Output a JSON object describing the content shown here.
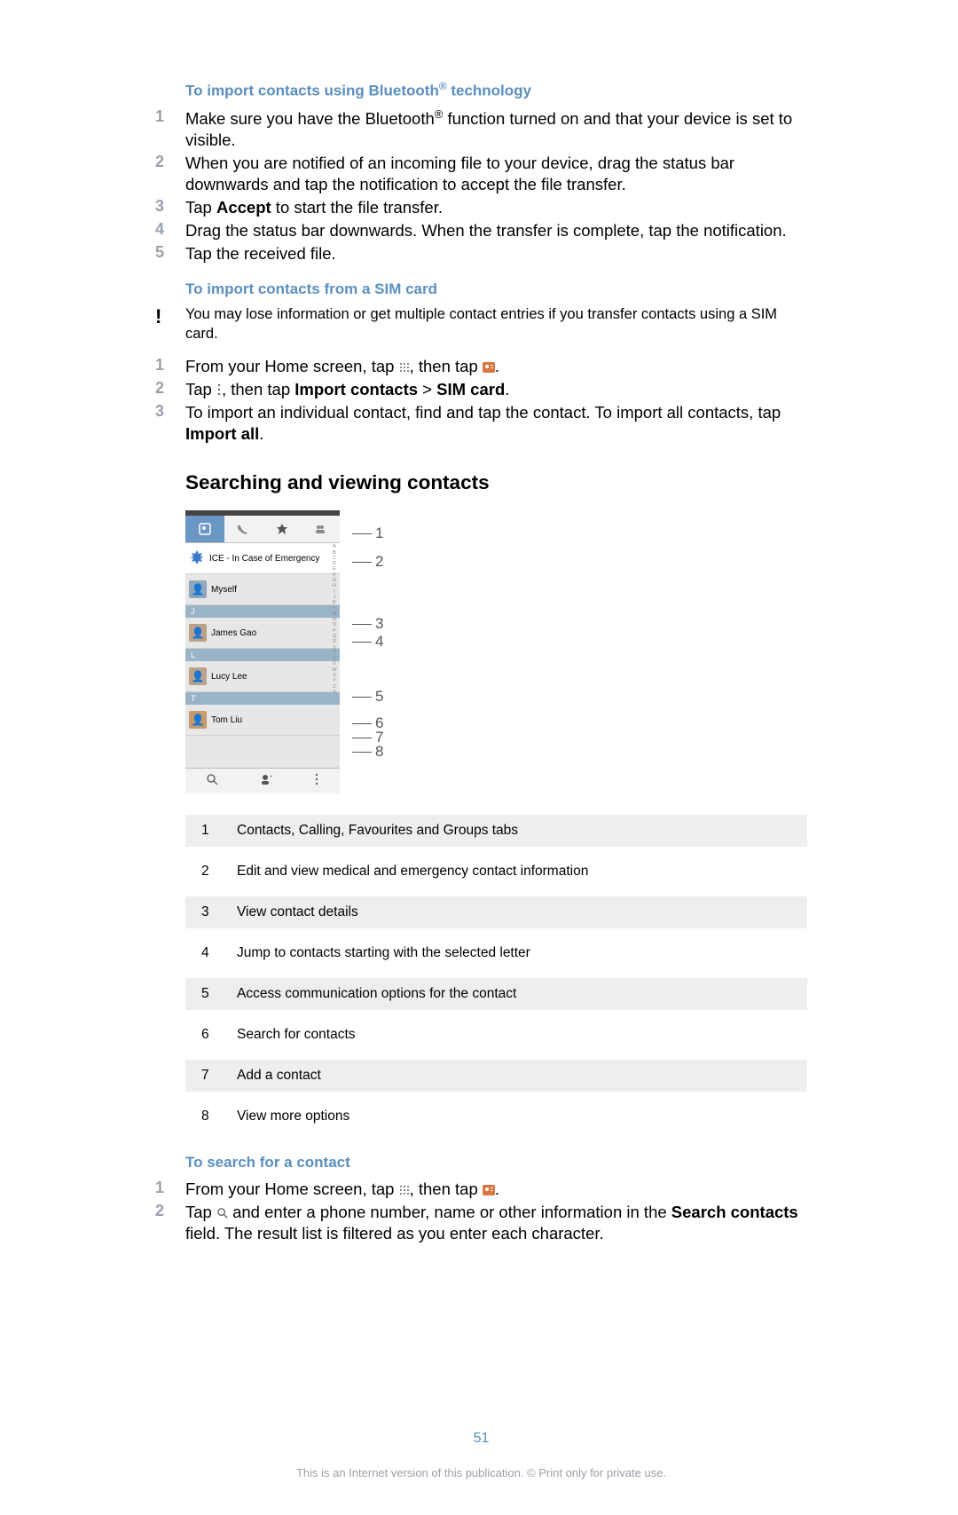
{
  "sections": {
    "bt_heading": "To import contacts using Bluetooth",
    "bt_sup": "®",
    "bt_heading2": " technology",
    "bt_steps": [
      {
        "n": "1",
        "text_before": "Make sure you have the Bluetooth",
        "sup": "®",
        "text_after": " function turned on and that your device is set to visible."
      },
      {
        "n": "2",
        "text": "When you are notified of an incoming file to your device, drag the status bar downwards and tap the notification to accept the file transfer."
      },
      {
        "n": "3",
        "text_before": "Tap ",
        "bold": "Accept",
        "text_after": " to start the file transfer."
      },
      {
        "n": "4",
        "text": "Drag the status bar downwards. When the transfer is complete, tap the notification."
      },
      {
        "n": "5",
        "text": "Tap the received file."
      }
    ],
    "sim_heading": "To import contacts from a SIM card",
    "sim_warning": "You may lose information or get multiple contact entries if you transfer contacts using a SIM card.",
    "sim_steps": {
      "s1_a": "From your Home screen, tap ",
      "s1_b": ", then tap ",
      "s1_c": ".",
      "s2_a": "Tap ",
      "s2_b": ", then tap ",
      "s2_bold1": "Import contacts",
      "s2_gt": " > ",
      "s2_bold2": "SIM card",
      "s2_c": ".",
      "s3_a": "To import an individual contact, find and tap the contact. To import all contacts, tap ",
      "s3_bold": "Import all",
      "s3_b": "."
    },
    "search_heading": "Searching and viewing contacts"
  },
  "phone": {
    "ice": "ICE - In Case of Emergency",
    "myself": "Myself",
    "letters": {
      "j": "J",
      "l": "L",
      "t": "T"
    },
    "james": "James Gao",
    "lucy": "Lucy Lee",
    "tom": "Tom Liu"
  },
  "callouts": [
    "1",
    "2",
    "3",
    "4",
    "5",
    "6",
    "7",
    "8"
  ],
  "legend": [
    {
      "n": "1",
      "t": "Contacts, Calling, Favourites and Groups tabs"
    },
    {
      "n": "2",
      "t": "Edit and view medical and emergency contact information"
    },
    {
      "n": "3",
      "t": "View contact details"
    },
    {
      "n": "4",
      "t": "Jump to contacts starting with the selected letter"
    },
    {
      "n": "5",
      "t": "Access communication options for the contact"
    },
    {
      "n": "6",
      "t": "Search for contacts"
    },
    {
      "n": "7",
      "t": "Add a contact"
    },
    {
      "n": "8",
      "t": "View more options"
    }
  ],
  "search_contact": {
    "heading": "To search for a contact",
    "s1_a": "From your Home screen, tap ",
    "s1_b": ", then tap ",
    "s1_c": ".",
    "s2_a": "Tap ",
    "s2_b": " and enter a phone number, name or other information in the ",
    "s2_bold": "Search contacts",
    "s2_c": " field. The result list is filtered as you enter each character."
  },
  "footer": {
    "page": "51",
    "copy": "This is an Internet version of this publication. © Print only for private use."
  }
}
